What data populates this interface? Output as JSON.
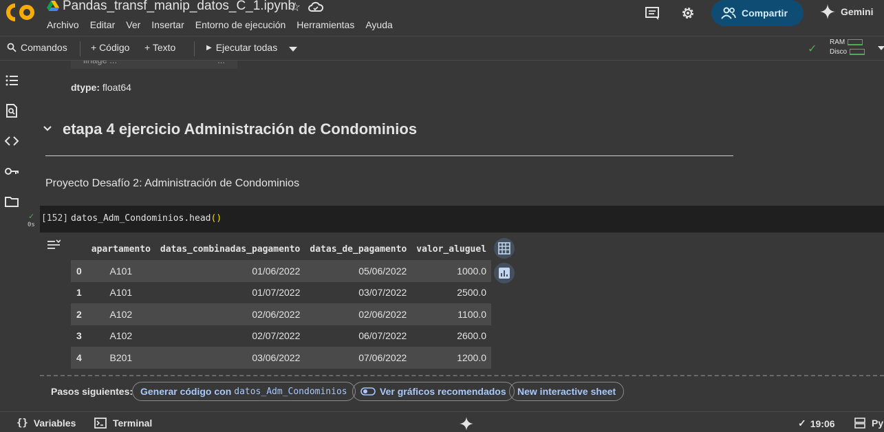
{
  "header": {
    "title": "Pandas_transf_manip_datos_C_1.ipynb",
    "menu": [
      "Archivo",
      "Editar",
      "Ver",
      "Insertar",
      "Entorno de ejecución",
      "Herramientas",
      "Ayuda"
    ],
    "share_label": "Compartir",
    "gemini_label": "Gemini",
    "logo_text": "CO"
  },
  "toolbar": {
    "commands_label": "Comandos",
    "code_label": "+ Código",
    "text_label": "+ Texto",
    "run_all_label": "Ejecutar todas",
    "ram_label": "RAM",
    "disk_label": "Disco"
  },
  "notebook": {
    "prev_output_label": "linage ...",
    "prev_output_value": "...",
    "dtype_label": "dtype:",
    "dtype_value": "float64",
    "section_title": "etapa 4 ejercicio Administración de Condominios",
    "subtitle": "Proyecto Desafío 2: Administración de Condominios",
    "cell": {
      "exec_count": "[152]",
      "code_prefix": "datos_Adm_Condominios.head",
      "code_paren": "()",
      "status_time": "0s"
    },
    "table": {
      "columns": [
        "apartamento",
        "datas_combinadas_pagamento",
        "datas_de_pagamento",
        "valor_aluguel"
      ],
      "rows": [
        {
          "idx": "0",
          "apartamento": "A101",
          "combinadas": "01/06/2022",
          "pagamento": "05/06/2022",
          "valor": "1000.0"
        },
        {
          "idx": "1",
          "apartamento": "A101",
          "combinadas": "01/07/2022",
          "pagamento": "03/07/2022",
          "valor": "2500.0"
        },
        {
          "idx": "2",
          "apartamento": "A102",
          "combinadas": "02/06/2022",
          "pagamento": "02/06/2022",
          "valor": "1100.0"
        },
        {
          "idx": "3",
          "apartamento": "A102",
          "combinadas": "02/07/2022",
          "pagamento": "06/07/2022",
          "valor": "2600.0"
        },
        {
          "idx": "4",
          "apartamento": "B201",
          "combinadas": "03/06/2022",
          "pagamento": "07/06/2022",
          "valor": "1200.0"
        }
      ]
    },
    "next_steps": {
      "label": "Pasos siguientes:",
      "generate_prefix": "Generar código con",
      "generate_var": "datos_Adm_Condominios",
      "charts_label": "Ver gráficos recomendados",
      "sheet_label": "New interactive sheet"
    }
  },
  "statusbar": {
    "variables_label": "Variables",
    "terminal_label": "Terminal",
    "time": "19:06",
    "python_label": "Py"
  },
  "colors": {
    "background": "#383838",
    "accent_blue": "#a8c7fa",
    "share_bg": "#0f4c73",
    "ok_green": "#4caf50"
  }
}
